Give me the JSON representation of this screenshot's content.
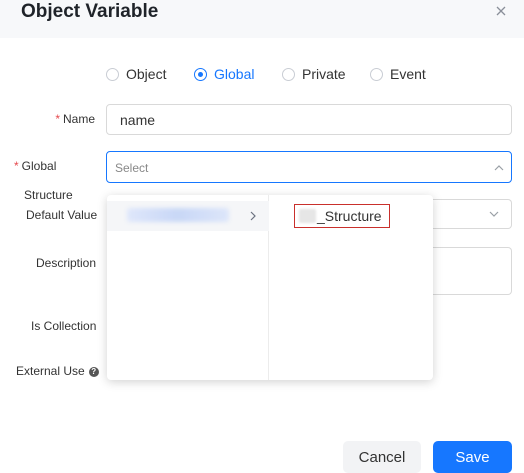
{
  "dialog": {
    "title": "Object Variable",
    "close_icon": "close-icon"
  },
  "scope": {
    "options": [
      "Object",
      "Global",
      "Private",
      "Event"
    ],
    "selected": "Global"
  },
  "form": {
    "required_mark": "*",
    "name_label": "Name",
    "name_value": "name",
    "global_label": "Global",
    "global_placeholder": "Select",
    "structure_label": "Structure",
    "default_value_label": "Default Value",
    "description_label": "Description",
    "is_collection_label": "Is Collection",
    "external_use_label": "External Use",
    "help_glyph": "?"
  },
  "dropdown": {
    "level2_option": "_Structure"
  },
  "buttons": {
    "cancel": "Cancel",
    "save": "Save"
  },
  "colors": {
    "accent": "#1677ff",
    "required": "#e5484d",
    "highlight_box": "#c9302c"
  }
}
